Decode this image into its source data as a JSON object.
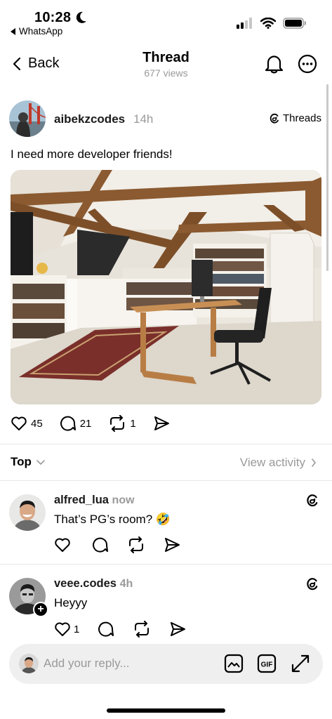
{
  "status_bar": {
    "time": "10:28",
    "back_app": "WhatsApp",
    "icons": [
      "moon-icon",
      "cellular-signal-icon",
      "wifi-icon",
      "battery-icon"
    ]
  },
  "nav": {
    "back_label": "Back",
    "title": "Thread",
    "views": "677 views",
    "icons": [
      "bell-icon",
      "more-icon"
    ]
  },
  "post": {
    "author": "aibekzcodes",
    "time": "14h",
    "badge": "Threads",
    "text": "I need more developer friends!",
    "likes": "45",
    "replies": "21",
    "reposts": "1"
  },
  "sort": {
    "label": "Top",
    "view_activity": "View activity"
  },
  "comments": [
    {
      "author": "alfred_lua",
      "time": "now",
      "text": "That’s PG’s room? 🤣",
      "likes": ""
    },
    {
      "author": "veee.codes",
      "time": "4h",
      "text": "Heyyy",
      "likes": "1"
    }
  ],
  "reply_bar": {
    "placeholder": "Add your reply...",
    "gif_label": "GIF",
    "icons": [
      "image-icon",
      "gif-icon",
      "expand-icon"
    ]
  }
}
